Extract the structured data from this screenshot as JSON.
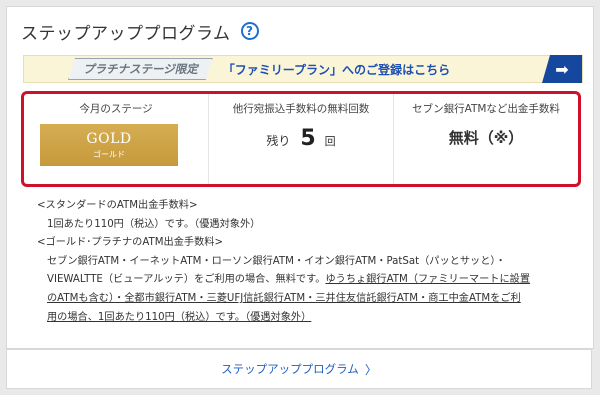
{
  "section": {
    "title": "ステップアッププログラム",
    "help_icon": "?"
  },
  "banner": {
    "tag": "プラチナステージ限定",
    "link": "「ファミリープラン」へのご登録はこちら",
    "arrow_icon": "➡"
  },
  "stats": {
    "stage": {
      "label": "今月のステージ",
      "badge_main": "GOLD",
      "badge_sub": "ゴールド"
    },
    "transfer": {
      "label": "他行宛振込手数料の無料回数",
      "prefix": "残り",
      "count": "5",
      "suffix": "回"
    },
    "atm": {
      "label": "セブン銀行ATMなど出金手数料",
      "value": "無料（※）"
    }
  },
  "notes": {
    "standard_title": "<スタンダードのATM出金手数料>",
    "standard_body": "1回あたり110円（税込）です。（優遇対象外）",
    "gold_title": "<ゴールド･プラチナのATM出金手数料>",
    "gold_line1": "セブン銀行ATM・イーネットATM・ローソン銀行ATM・イオン銀行ATM・PatSat（パッとサッと）・",
    "gold_line2_plain": "VIEWALTTE（ビューアルッテ）をご利用の場合、無料です。",
    "gold_line2_ul": "ゆうちょ銀行ATM（ファミリーマートに設置",
    "gold_line3": "のATMも含む）・全都市銀行ATM・三菱UFJ信託銀行ATM・三井住友信託銀行ATM・商工中金ATMをご利",
    "gold_line4": "用の場合、1回あたり110円（税込）です。（優遇対象外）"
  },
  "footer": {
    "link": "ステップアッププログラム",
    "chevron": "〉"
  }
}
